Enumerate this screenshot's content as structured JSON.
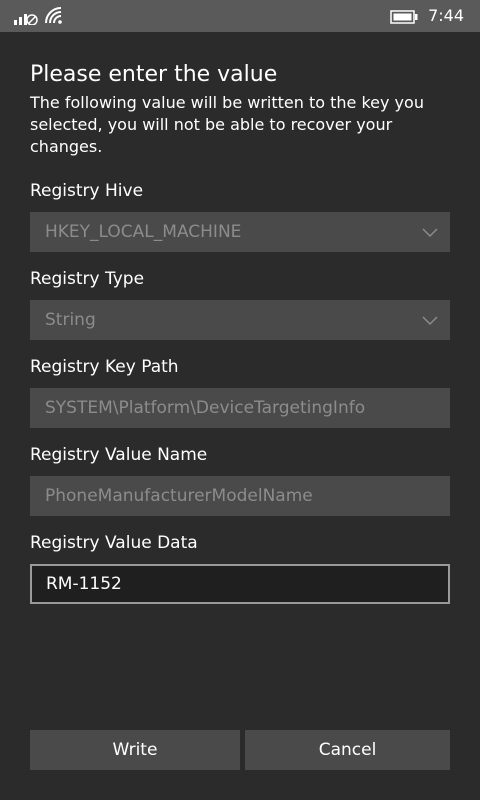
{
  "status": {
    "time": "7:44"
  },
  "dialog": {
    "title": "Please enter the value",
    "description": "The following value will be written to the key you selected, you will not be able to recover your changes."
  },
  "fields": {
    "hive_label": "Registry Hive",
    "hive_value": "HKEY_LOCAL_MACHINE",
    "type_label": "Registry Type",
    "type_value": "String",
    "path_label": "Registry Key Path",
    "path_value": "SYSTEM\\Platform\\DeviceTargetingInfo",
    "name_label": "Registry Value Name",
    "name_value": "PhoneManufacturerModelName",
    "data_label": "Registry Value Data",
    "data_value": "RM-1152"
  },
  "buttons": {
    "write": "Write",
    "cancel": "Cancel"
  }
}
